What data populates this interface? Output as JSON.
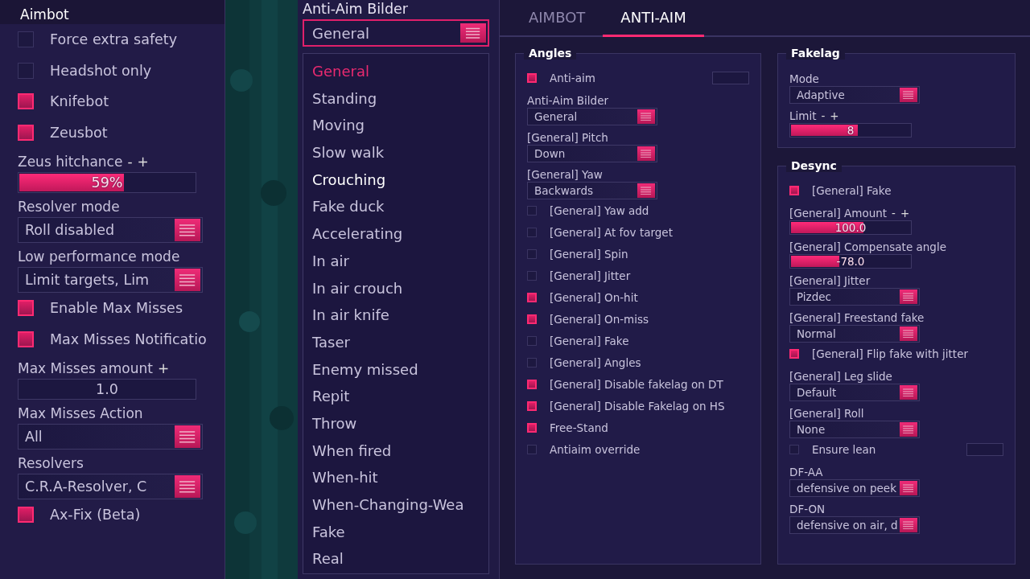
{
  "aimbot": {
    "title": "Aimbot",
    "controls": [
      {
        "kind": "checkbox",
        "label": "Force extra safety",
        "checked": false
      },
      {
        "kind": "checkbox",
        "label": "Headshot only",
        "checked": false
      },
      {
        "kind": "checkbox",
        "label": "Knifebot",
        "checked": true
      },
      {
        "kind": "checkbox",
        "label": "Zeusbot",
        "checked": true
      },
      {
        "kind": "slider",
        "label": "Zeus hitchance",
        "steppers": [
          "-",
          "+"
        ],
        "value": "59%",
        "level": 0.59
      },
      {
        "kind": "dropdown",
        "label": "Resolver mode",
        "value": "Roll disabled"
      },
      {
        "kind": "dropdown",
        "label": "Low performance mode",
        "value": "Limit targets, Lim"
      },
      {
        "kind": "checkbox",
        "label": "Enable Max Misses",
        "checked": true
      },
      {
        "kind": "checkbox",
        "label": "Max Misses Notificatio",
        "checked": true
      },
      {
        "kind": "number",
        "label": "Max Misses amount",
        "steppers": [
          "+"
        ],
        "value": "1.0"
      },
      {
        "kind": "dropdown",
        "label": "Max Misses Action",
        "value": "All"
      },
      {
        "kind": "dropdown",
        "label": "Resolvers",
        "value": "C.R.A-Resolver, C"
      },
      {
        "kind": "checkbox",
        "label": "Ax-Fix (Beta)",
        "checked": true
      }
    ]
  },
  "builder": {
    "title": "Anti-Aim Bilder",
    "value": "General",
    "options": [
      {
        "label": "General",
        "selected": true,
        "hovered": false
      },
      {
        "label": "Standing",
        "selected": false,
        "hovered": false
      },
      {
        "label": "Moving",
        "selected": false,
        "hovered": false
      },
      {
        "label": "Slow walk",
        "selected": false,
        "hovered": false
      },
      {
        "label": "Crouching",
        "selected": false,
        "hovered": true
      },
      {
        "label": "Fake duck",
        "selected": false,
        "hovered": false
      },
      {
        "label": "Accelerating",
        "selected": false,
        "hovered": false
      },
      {
        "label": "In air",
        "selected": false,
        "hovered": false
      },
      {
        "label": "In air crouch",
        "selected": false,
        "hovered": false
      },
      {
        "label": "In air knife",
        "selected": false,
        "hovered": false
      },
      {
        "label": "Taser",
        "selected": false,
        "hovered": false
      },
      {
        "label": "Enemy missed",
        "selected": false,
        "hovered": false
      },
      {
        "label": "Repit",
        "selected": false,
        "hovered": false
      },
      {
        "label": "Throw",
        "selected": false,
        "hovered": false
      },
      {
        "label": "When fired",
        "selected": false,
        "hovered": false
      },
      {
        "label": "When-hit",
        "selected": false,
        "hovered": false
      },
      {
        "label": "When-Changing-Wea",
        "selected": false,
        "hovered": false
      },
      {
        "label": "Fake",
        "selected": false,
        "hovered": false
      },
      {
        "label": "Real",
        "selected": false,
        "hovered": false
      }
    ]
  },
  "tabs": [
    {
      "label": "AIMBOT",
      "selected": false
    },
    {
      "label": "ANTI-AIM",
      "selected": true
    }
  ],
  "angles": {
    "title": "Angles",
    "controls": [
      {
        "kind": "checkbox",
        "label": "Anti-aim",
        "checked": true,
        "keybind": true
      },
      {
        "kind": "dropdown",
        "label": "Anti-Aim Bilder",
        "value": "General"
      },
      {
        "kind": "dropdown",
        "label": "[General] Pitch",
        "value": "Down"
      },
      {
        "kind": "dropdown",
        "label": "[General] Yaw",
        "value": "Backwards"
      },
      {
        "kind": "checkbox",
        "label": "[General] Yaw add",
        "checked": false
      },
      {
        "kind": "checkbox",
        "label": "[General] At fov target",
        "checked": false
      },
      {
        "kind": "checkbox",
        "label": "[General] Spin",
        "checked": false
      },
      {
        "kind": "checkbox",
        "label": "[General] Jitter",
        "checked": false
      },
      {
        "kind": "checkbox",
        "label": "[General] On-hit",
        "checked": true
      },
      {
        "kind": "checkbox",
        "label": "[General] On-miss",
        "checked": true
      },
      {
        "kind": "checkbox",
        "label": "[General] Fake",
        "checked": false
      },
      {
        "kind": "checkbox",
        "label": "[General] Angles",
        "checked": false
      },
      {
        "kind": "checkbox",
        "label": "[General] Disable fakelag on DT",
        "checked": true
      },
      {
        "kind": "checkbox",
        "label": "[General] Disable Fakelag on HS",
        "checked": true
      },
      {
        "kind": "checkbox",
        "label": "Free-Stand",
        "checked": true
      },
      {
        "kind": "checkbox",
        "label": "Antiaim override",
        "checked": false
      }
    ]
  },
  "fakelag": {
    "title": "Fakelag",
    "controls": [
      {
        "kind": "dropdown",
        "label": "Mode",
        "value": "Adaptive"
      },
      {
        "kind": "slider",
        "label": "Limit",
        "steppers": [
          "-",
          "+"
        ],
        "value": "8",
        "level": 0.55
      }
    ]
  },
  "desync": {
    "title": "Desync",
    "controls": [
      {
        "kind": "checkbox",
        "label": "[General] Fake",
        "checked": true
      },
      {
        "kind": "slider",
        "label": "[General] Amount",
        "steppers": [
          "-",
          "+"
        ],
        "value": "100.0",
        "level": 0.6
      },
      {
        "kind": "slider",
        "label": "[General] Compensate angle",
        "value": "-78.0",
        "level": 0.4
      },
      {
        "kind": "dropdown",
        "label": "[General] Jitter",
        "value": "Pizdec"
      },
      {
        "kind": "dropdown",
        "label": "[General] Freestand fake",
        "value": "Normal"
      },
      {
        "kind": "checkbox",
        "label": "[General] Flip fake with jitter",
        "checked": true
      },
      {
        "kind": "dropdown",
        "label": "[General] Leg slide",
        "value": "Default"
      },
      {
        "kind": "dropdown",
        "label": "[General] Roll",
        "value": "None"
      },
      {
        "kind": "checkbox",
        "label": "Ensure lean",
        "checked": false,
        "keybind": true
      },
      {
        "kind": "dropdown",
        "label": "DF-AA",
        "value": "defensive on peek"
      },
      {
        "kind": "dropdown",
        "label": "DF-ON",
        "value": "defensive on air, d"
      }
    ]
  }
}
